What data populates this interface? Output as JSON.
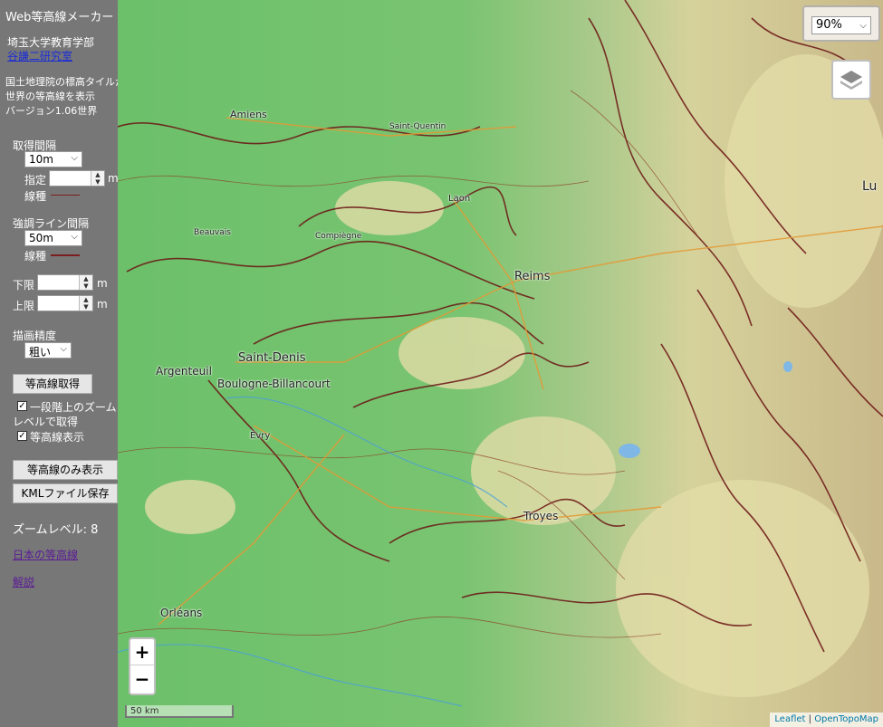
{
  "sidebar": {
    "app_title": "Web等高線メーカー",
    "university": "埼玉大学教育学部",
    "lab_link": "谷謙二研究室",
    "desc_line1": "国土地理院の標高タイルか",
    "desc_line2": "世界の等高線を表示",
    "version": "バージョン1.06世界",
    "interval_label": "取得間隔",
    "interval_value": "10m",
    "custom_label": "指定",
    "custom_unit": "m",
    "linetype_label": "線種",
    "emphasis_label": "強調ライン間隔",
    "emphasis_value": "50m",
    "linetype2_label": "線種",
    "lower_label": "下限",
    "lower_unit": "m",
    "upper_label": "上限",
    "upper_unit": "m",
    "precision_label": "描画精度",
    "precision_value": "粗い",
    "get_button": "等高線取得",
    "zoom_check_line1": "一段階上のズーム",
    "zoom_check_line2": "レベルで取得",
    "show_check": "等高線表示",
    "contour_only_button": "等高線のみ表示",
    "kml_button": "KMLファイル保存",
    "zoom_level": "ズームレベル: 8",
    "japan_link": "日本の等高線",
    "explain_link": "解説"
  },
  "map": {
    "opacity_value": "90%",
    "zoom_in": "+",
    "zoom_out": "−",
    "scale": "50 km",
    "attribution_leaflet": "Leaflet",
    "attribution_sep": " | ",
    "attribution_otm": "OpenTopoMap",
    "labels": {
      "amiens": "Amiens",
      "saint_quentin": "Saint-Quentin",
      "laon": "Laon",
      "beauvais": "Beauvais",
      "compiegne": "Compiègne",
      "reims": "Reims",
      "saint_denis": "Saint-Denis",
      "argenteuil": "Argenteuil",
      "boulogne": "Boulogne-Billancourt",
      "evry": "Évry",
      "troyes": "Troyes",
      "orleans": "Orléans",
      "right_edge": "Lu"
    }
  },
  "colors": {
    "sidebar_bg": "#777777",
    "contour": "#6b1414",
    "lowland": "#6fbf6a",
    "upland": "#d9d39a"
  }
}
